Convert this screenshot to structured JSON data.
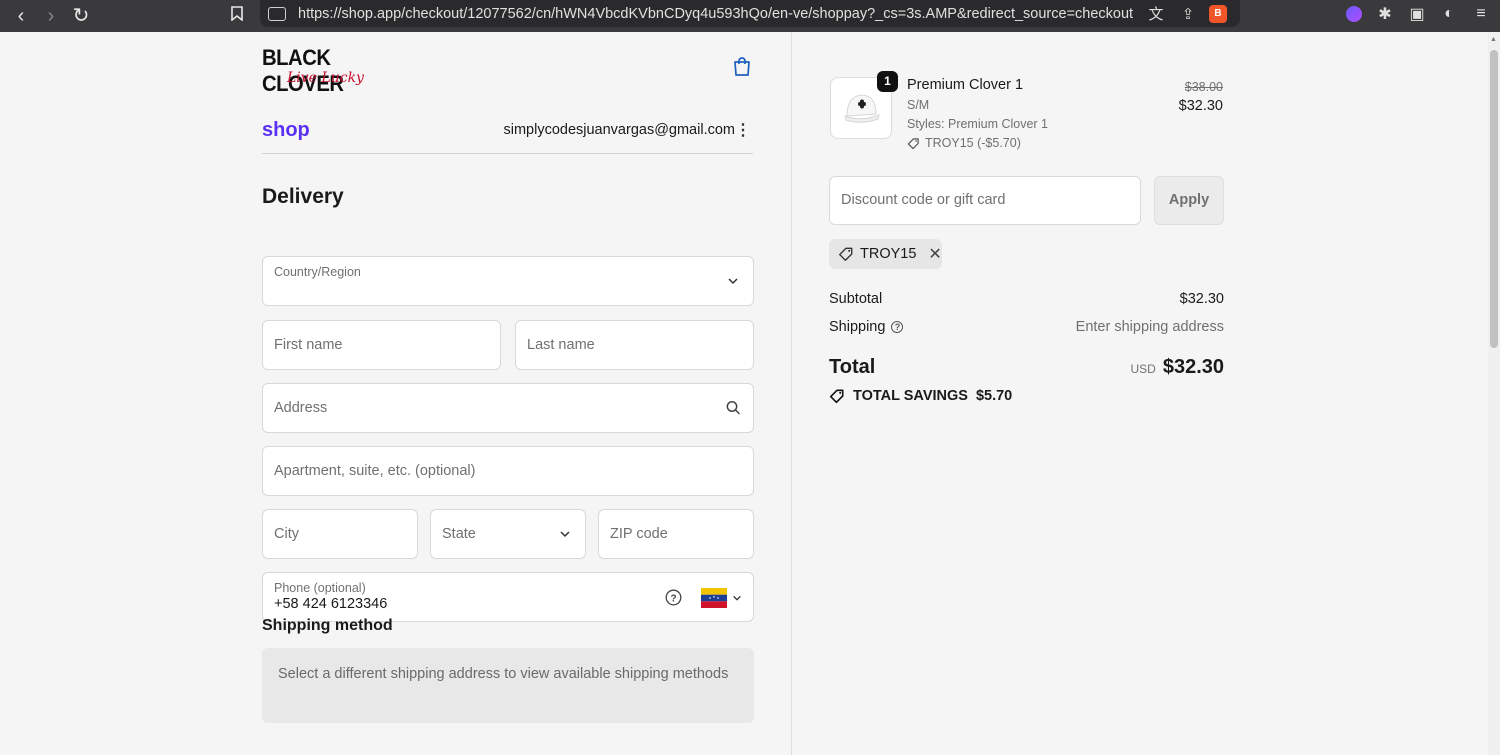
{
  "browser": {
    "url": "https://shop.app/checkout/12077562/cn/hWN4VbcdKVbnCDyq4u593hQo/en-ve/shoppay?_cs=3s.AMP&redirect_source=checkout_auto...",
    "nav_back": "‹",
    "nav_forward": "›",
    "reload": "↻"
  },
  "header": {
    "logo_line1": "BLACK CLOVER",
    "logo_line2": "Live Lucky",
    "shop_label": "shop",
    "email": "simplycodesjuanvargas@gmail.com"
  },
  "delivery": {
    "heading": "Delivery",
    "country_label": "Country/Region",
    "first_name_placeholder": "First name",
    "last_name_placeholder": "Last name",
    "address_placeholder": "Address",
    "apartment_placeholder": "Apartment, suite, etc. (optional)",
    "city_placeholder": "City",
    "state_placeholder": "State",
    "zip_placeholder": "ZIP code",
    "phone_label": "Phone (optional)",
    "phone_value": "+58 424 6123346"
  },
  "shipping_method": {
    "heading": "Shipping method",
    "message": "Select a different shipping address to view available shipping methods"
  },
  "summary": {
    "item": {
      "quantity": "1",
      "name": "Premium Clover 1",
      "variant": "S/M",
      "styles": "Styles: Premium Clover 1",
      "discount": "TROY15 (-$5.70)",
      "original_price": "$38.00",
      "price": "$32.30"
    },
    "discount_placeholder": "Discount code or gift card",
    "apply_label": "Apply",
    "applied_code": "TROY15",
    "subtotal_label": "Subtotal",
    "subtotal_value": "$32.30",
    "shipping_label": "Shipping",
    "shipping_value": "Enter shipping address",
    "total_label": "Total",
    "currency": "USD",
    "total_value": "$32.30",
    "savings_label": "TOTAL SAVINGS",
    "savings_value": "$5.70"
  },
  "colors": {
    "shop_purple": "#5a31f4",
    "brand_red": "#c8102e",
    "apply_bg": "#ebebeb"
  }
}
